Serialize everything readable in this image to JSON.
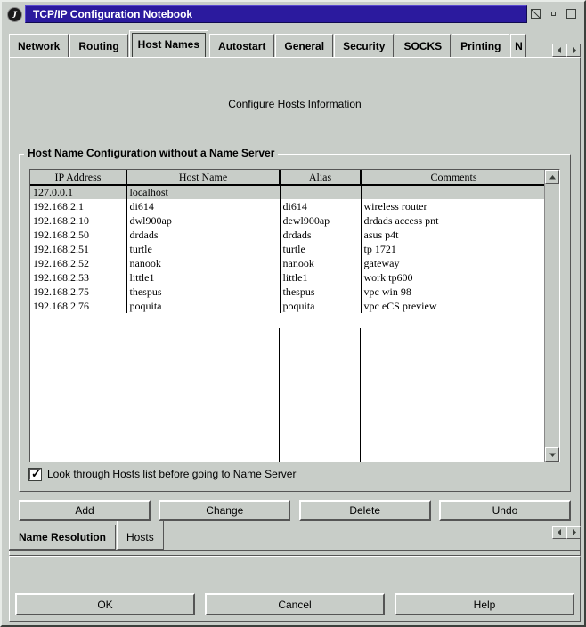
{
  "window": {
    "title": "TCP/IP Configuration Notebook",
    "sysmenu_glyph": "J",
    "controls": [
      {
        "name": "hide-button",
        "label": "Hide"
      },
      {
        "name": "minimize-button",
        "label": "Minimize"
      },
      {
        "name": "maximize-button",
        "label": "Maximize"
      }
    ],
    "titlebar_color": "#2b1a9e",
    "face_color": "#c8cdc8"
  },
  "top_tabs": {
    "items": [
      {
        "label": "Network",
        "selected": false
      },
      {
        "label": "Routing",
        "selected": false
      },
      {
        "label": "Host Names",
        "selected": true
      },
      {
        "label": "Autostart",
        "selected": false
      },
      {
        "label": "General",
        "selected": false
      },
      {
        "label": "Security",
        "selected": false
      },
      {
        "label": "SOCKS",
        "selected": false
      },
      {
        "label": "Printing",
        "selected": false
      },
      {
        "label": "N",
        "selected": false,
        "truncated": true
      }
    ],
    "scroll_left_label": "Scroll tabs left",
    "scroll_right_label": "Scroll tabs right"
  },
  "page": {
    "heading": "Configure Hosts Information",
    "group_title": "Host Name Configuration without a Name Server"
  },
  "table": {
    "columns": [
      "IP Address",
      "Host Name",
      "Alias",
      "Comments"
    ],
    "rows": [
      {
        "ip": "127.0.0.1",
        "host": "localhost",
        "alias": "",
        "comments": "",
        "selected": true
      },
      {
        "ip": "192.168.2.1",
        "host": "di614",
        "alias": "di614",
        "comments": "wireless router",
        "selected": false
      },
      {
        "ip": "192.168.2.10",
        "host": "dwl900ap",
        "alias": "dewl900ap",
        "comments": "drdads access pnt",
        "selected": false
      },
      {
        "ip": "192.168.2.50",
        "host": "drdads",
        "alias": "drdads",
        "comments": "asus p4t",
        "selected": false
      },
      {
        "ip": "192.168.2.51",
        "host": "turtle",
        "alias": "turtle",
        "comments": "tp 1721",
        "selected": false
      },
      {
        "ip": "192.168.2.52",
        "host": "nanook",
        "alias": "nanook",
        "comments": "gateway",
        "selected": false
      },
      {
        "ip": "192.168.2.53",
        "host": "little1",
        "alias": "little1",
        "comments": "work tp600",
        "selected": false
      },
      {
        "ip": "192.168.2.75",
        "host": "thespus",
        "alias": "thespus",
        "comments": "vpc win 98",
        "selected": false
      },
      {
        "ip": "192.168.2.76",
        "host": "poquita",
        "alias": "poquita",
        "comments": "vpc eCS preview",
        "selected": false
      }
    ],
    "scroll_up_label": "Scroll up",
    "scroll_down_label": "Scroll down"
  },
  "checkbox": {
    "label": "Look through Hosts list before going to Name Server",
    "checked": true,
    "tick": "✓"
  },
  "action_buttons": [
    {
      "label": "Add"
    },
    {
      "label": "Change"
    },
    {
      "label": "Delete"
    },
    {
      "label": "Undo"
    }
  ],
  "bottom_tabs": {
    "items": [
      {
        "label": "Name Resolution",
        "selected": false
      },
      {
        "label": "Hosts",
        "selected": true
      }
    ],
    "scroll_left_label": "Scroll tabs left",
    "scroll_right_label": "Scroll tabs right"
  },
  "footer_buttons": [
    {
      "label": "OK"
    },
    {
      "label": "Cancel"
    },
    {
      "label": "Help"
    }
  ]
}
